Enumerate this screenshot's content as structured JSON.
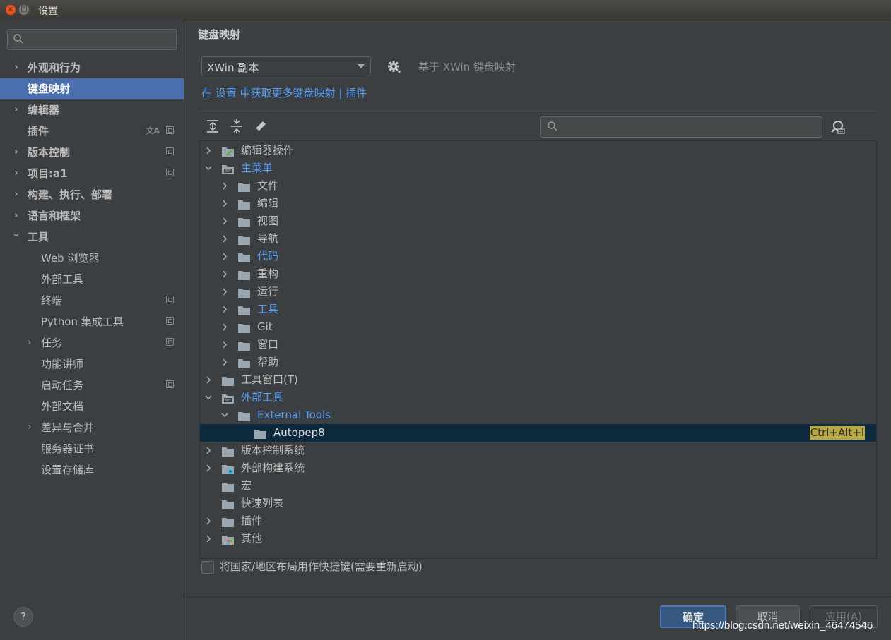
{
  "window": {
    "title": "设置",
    "close": "×",
    "maximize": "□"
  },
  "sidebar": {
    "items": [
      {
        "label": "外观和行为",
        "expandable": true,
        "bold": true
      },
      {
        "label": "键盘映射",
        "selected": true,
        "bold": true
      },
      {
        "label": "编辑器",
        "expandable": true,
        "bold": true
      },
      {
        "label": "插件",
        "bold": true,
        "translate_icon": true,
        "project_icon": true
      },
      {
        "label": "版本控制",
        "expandable": true,
        "bold": true,
        "project_icon": true
      },
      {
        "label": "项目:a1",
        "expandable": true,
        "bold": true,
        "project_icon": true
      },
      {
        "label": "构建、执行、部署",
        "expandable": true,
        "bold": true
      },
      {
        "label": "语言和框架",
        "expandable": true,
        "bold": true
      },
      {
        "label": "工具",
        "expanded": true,
        "bold": true
      },
      {
        "label": "Web 浏览器",
        "indent": 1
      },
      {
        "label": "外部工具",
        "indent": 1
      },
      {
        "label": "终端",
        "indent": 1,
        "project_icon": true
      },
      {
        "label": "Python 集成工具",
        "indent": 1,
        "project_icon": true
      },
      {
        "label": "任务",
        "indent": 1,
        "expandable": true,
        "project_icon": true
      },
      {
        "label": "功能讲师",
        "indent": 1
      },
      {
        "label": "启动任务",
        "indent": 1,
        "project_icon": true
      },
      {
        "label": "外部文档",
        "indent": 1
      },
      {
        "label": "差异与合并",
        "indent": 1,
        "expandable": true
      },
      {
        "label": "服务器证书",
        "indent": 1
      },
      {
        "label": "设置存储库",
        "indent": 1
      }
    ],
    "help": "?"
  },
  "main": {
    "title": "键盘映射",
    "keymap_value": "XWin 副本",
    "keymap_desc": "基于 XWin 键盘映射",
    "get_more": {
      "prefix": "在",
      "settings_link": "设置",
      "middle": "中获取更多键盘映射",
      "separator": "|",
      "plugins_link": "插件"
    }
  },
  "tree": [
    {
      "label": "编辑器操作",
      "depth": 0,
      "chev": "right",
      "icon": "editor-actions"
    },
    {
      "label": "主菜单",
      "depth": 0,
      "chev": "down",
      "icon": "menu",
      "color": "blue"
    },
    {
      "label": "文件",
      "depth": 1,
      "chev": "right",
      "icon": "folder"
    },
    {
      "label": "编辑",
      "depth": 1,
      "chev": "right",
      "icon": "folder"
    },
    {
      "label": "视图",
      "depth": 1,
      "chev": "right",
      "icon": "folder"
    },
    {
      "label": "导航",
      "depth": 1,
      "chev": "right",
      "icon": "folder"
    },
    {
      "label": "代码",
      "depth": 1,
      "chev": "right",
      "icon": "folder",
      "color": "blue"
    },
    {
      "label": "重构",
      "depth": 1,
      "chev": "right",
      "icon": "folder"
    },
    {
      "label": "运行",
      "depth": 1,
      "chev": "right",
      "icon": "folder"
    },
    {
      "label": "工具",
      "depth": 1,
      "chev": "right",
      "icon": "folder",
      "color": "blue"
    },
    {
      "label": "Git",
      "depth": 1,
      "chev": "right",
      "icon": "folder"
    },
    {
      "label": "窗口",
      "depth": 1,
      "chev": "right",
      "icon": "folder"
    },
    {
      "label": "帮助",
      "depth": 1,
      "chev": "right",
      "icon": "folder"
    },
    {
      "label": "工具窗口(T)",
      "depth": 0,
      "chev": "right",
      "icon": "folder"
    },
    {
      "label": "外部工具",
      "depth": 0,
      "chev": "down",
      "icon": "menu",
      "color": "blue"
    },
    {
      "label": "External Tools",
      "depth": 1,
      "chev": "down",
      "icon": "folder",
      "color": "blue"
    },
    {
      "label": "Autopep8",
      "depth": 2,
      "chev": "none",
      "icon": "folder",
      "selected": true,
      "shortcut": "Ctrl+Alt+l"
    },
    {
      "label": "版本控制系统",
      "depth": 0,
      "chev": "right",
      "icon": "folder"
    },
    {
      "label": "外部构建系统",
      "depth": 0,
      "chev": "right",
      "icon": "gear-folder"
    },
    {
      "label": "宏",
      "depth": 0,
      "chev": "none",
      "icon": "folder"
    },
    {
      "label": "快速列表",
      "depth": 0,
      "chev": "none",
      "icon": "folder"
    },
    {
      "label": "插件",
      "depth": 0,
      "chev": "right",
      "icon": "folder"
    },
    {
      "label": "其他",
      "depth": 0,
      "chev": "right",
      "icon": "other"
    }
  ],
  "footer": {
    "rtl_checkbox": "将国家/地区布局用作快捷键(需要重新启动)",
    "ok": "确定",
    "cancel": "取消",
    "apply": "应用(A)"
  },
  "watermark": "https://blog.csdn.net/weixin_46474546",
  "icons": {
    "expand_all": "expand-all-icon",
    "collapse_all": "collapse-all-icon",
    "edit": "pencil-icon",
    "find_shortcut": "find-by-shortcut-icon",
    "gear": "gear-icon",
    "search": "search-icon"
  },
  "colors": {
    "selection": "#4b6eaf",
    "link": "#589df6",
    "tree_selection": "#0d293e",
    "shortcut_highlight": "#b8a940"
  }
}
